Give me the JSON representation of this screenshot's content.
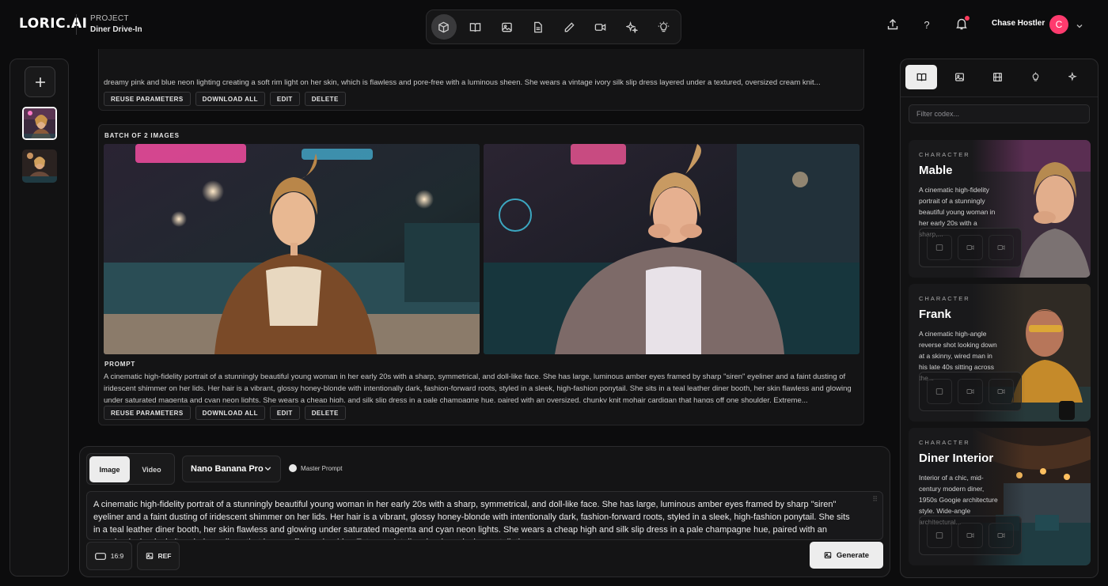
{
  "app": {
    "logo": "LORIC.AI",
    "project_label": "PROJECT",
    "project_name": "Diner Drive-In"
  },
  "toolbar": {
    "tools": [
      "cube-icon",
      "book-icon",
      "image-icon",
      "document-icon",
      "pencil-icon",
      "video-icon",
      "sparkle-icon",
      "bulb-icon"
    ]
  },
  "user": {
    "name": "Chase Hostler",
    "initial": "C"
  },
  "cards": [
    {
      "prompt_fragment": "dreamy pink and blue neon lighting creating a soft rim light on her skin, which is flawless and pore-free with a luminous sheen. She wears a vintage ivory silk slip dress layered under a textured, oversized cream knit...",
      "actions": [
        "REUSE PARAMETERS",
        "DOWNLOAD ALL",
        "EDIT",
        "DELETE"
      ]
    },
    {
      "batch_label": "BATCH OF 2 IMAGES",
      "prompt_label": "PROMPT",
      "prompt": "A cinematic high-fidelity portrait of a stunningly beautiful young woman in her early 20s with a sharp, symmetrical, and doll-like face. She has large, luminous amber eyes framed by sharp \"siren\" eyeliner and a faint dusting of iridescent shimmer on her lids. Her hair is a vibrant, glossy honey-blonde with intentionally dark, fashion-forward roots, styled in a sleek, high-fashion ponytail. She sits in a teal leather diner booth, her skin flawless and glowing under saturated magenta and cyan neon lights. She wears a cheap high, and silk slip dress in a pale champagne hue, paired with an oversized, chunky knit mohair cardigan that hangs off one shoulder. Extreme...",
      "actions": [
        "REUSE PARAMETERS",
        "DOWNLOAD ALL",
        "EDIT",
        "DELETE"
      ]
    }
  ],
  "composer": {
    "modes": [
      "Image",
      "Video"
    ],
    "active_mode": "Image",
    "model": "Nano Banana Pro",
    "master_prompt_label": "Master Prompt",
    "prompt": "A cinematic high-fidelity portrait of a stunningly beautiful young woman in her early 20s with a sharp, symmetrical, and doll-like face. She has large, luminous amber eyes framed by sharp \"siren\" eyeliner and a faint dusting of iridescent shimmer on her lids. Her hair is a vibrant, glossy honey-blonde with intentionally dark, fashion-forward roots, styled in a sleek, high-fashion ponytail. She sits in a teal leather diner booth, her skin flawless and glowing under saturated magenta and cyan neon lights. She wears a cheap high and silk slip dress in a pale champagne hue, paired with an oversized, chunky knit mohair cardigan that hangs off one shoulder. Extreme detail on her long, lash-constellation...",
    "aspect": "16:9",
    "ref_label": "REF",
    "generate_label": "Generate"
  },
  "codex": {
    "filter_placeholder": "Filter codex...",
    "tabs": [
      "book-icon",
      "image-icon",
      "film-icon",
      "bulb-icon",
      "sparkle-icon"
    ],
    "items": [
      {
        "type": "CHARACTER",
        "name": "Mable",
        "desc": "A cinematic high-fidelity portrait of a stunningly beautiful young woman in her early 20s with a sharp,..."
      },
      {
        "type": "CHARACTER",
        "name": "Frank",
        "desc": "A cinematic high-angle reverse shot looking down at a skinny, wired man in his late 40s sitting across the..."
      },
      {
        "type": "CHARACTER",
        "name": "Diner Interior",
        "desc": "Interior of a chic, mid-century modern diner, 1950s Googie architecture style. Wide-angle architectural..."
      }
    ]
  },
  "colors": {
    "accent": "#ff3b6e",
    "background": "#0c0c0d",
    "panel": "#121213"
  }
}
